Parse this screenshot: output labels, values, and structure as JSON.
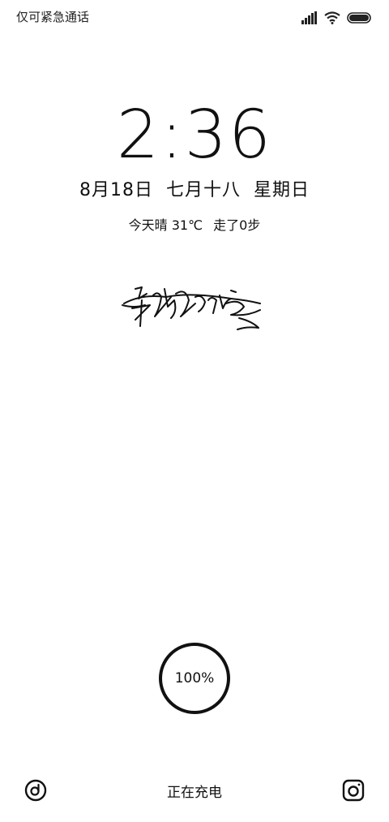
{
  "status_bar": {
    "carrier_text": "仅可紧急通话",
    "icons": [
      "signal-icon",
      "wifi-icon",
      "battery-icon"
    ]
  },
  "lock_screen": {
    "time": "2:36",
    "date": "8月18日  七月十八  星期日",
    "weather": "今天晴 31℃",
    "steps": "走了0步"
  },
  "battery": {
    "percent_label": "100%",
    "level_percent": 100
  },
  "bottom_bar": {
    "left_icon": "shortcut-circle-icon",
    "center_label": "正在充电",
    "right_icon": "camera-icon"
  },
  "colors": {
    "background": "#ffffff",
    "foreground": "#111111"
  }
}
